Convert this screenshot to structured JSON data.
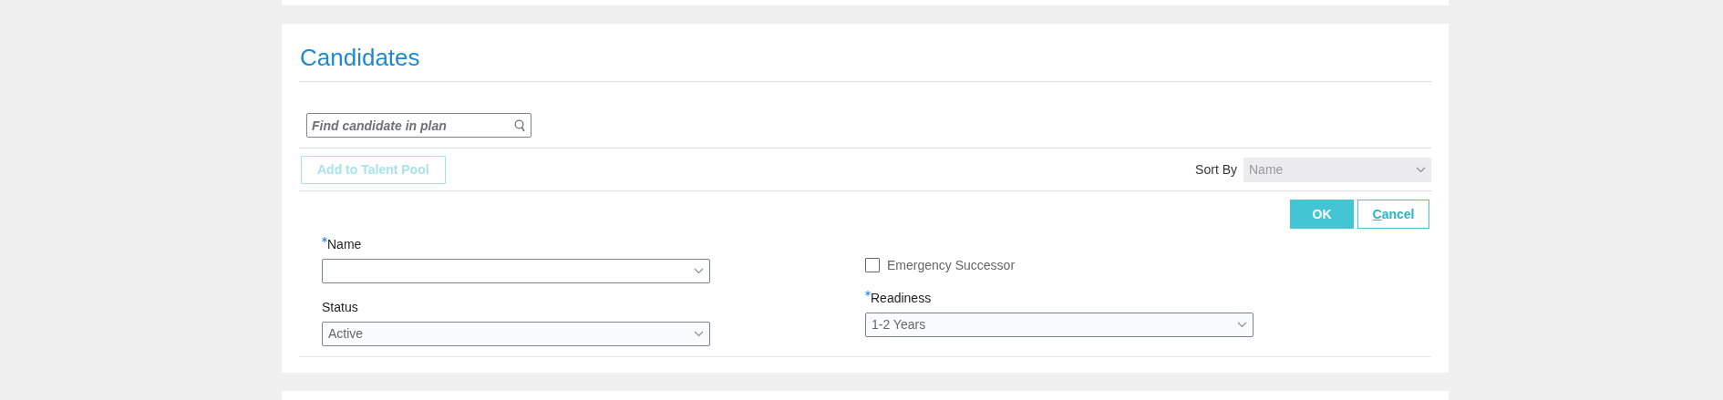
{
  "section": {
    "title": "Candidates"
  },
  "search": {
    "placeholder": "Find candidate in plan"
  },
  "toolbar": {
    "add_button": {
      "label": "Add to Talent Pool",
      "disabled": true
    },
    "sort_by": {
      "label": "Sort By",
      "value": "Name",
      "disabled": true
    }
  },
  "actions": [
    {
      "kind": "primary",
      "label": "OK"
    },
    {
      "kind": "secondary",
      "label": "Cancel"
    }
  ],
  "form": {
    "left": [
      {
        "kind": "select",
        "label": "Name",
        "required": true
      },
      {
        "kind": "select",
        "label": "Status",
        "value": "Active"
      }
    ],
    "right": [
      {
        "kind": "checkbox",
        "label": "Emergency Successor",
        "checked": false
      },
      {
        "kind": "select",
        "label": "Readiness",
        "required": true,
        "value": "1-2 Years"
      }
    ]
  }
}
